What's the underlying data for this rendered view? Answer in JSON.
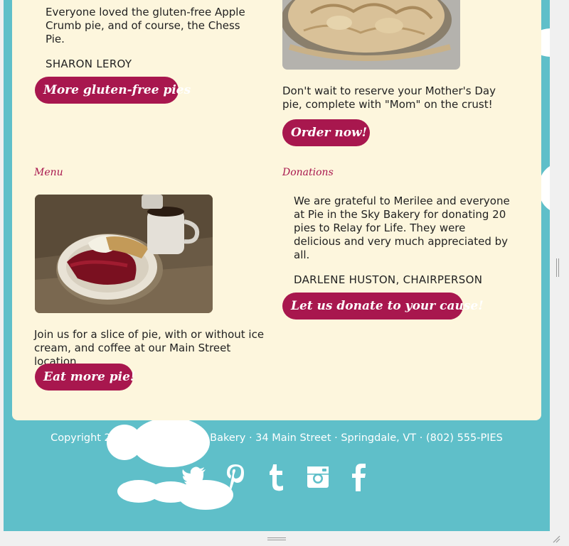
{
  "testimonial_top": {
    "quote": "Everyone loved the gluten-free Apple Crumb pie, and of course, the Chess Pie.",
    "author": "SHARON LEROY",
    "button": "More gluten-free pies"
  },
  "mothers_day": {
    "text": "Don't wait to reserve your Mother's Day pie, complete with \"Mom\" on the crust!",
    "button": "Order now!"
  },
  "menu": {
    "heading": "Menu",
    "text": "Join us for a slice of pie, with or without ice cream, and coffee at our Main Street location.",
    "button": "Eat more pie!"
  },
  "donations": {
    "heading": "Donations",
    "quote": "We are grateful to Merilee and everyone at Pie in the Sky Bakery for donating 20 pies to Relay for Life. They were delicious and very much appreciated by all.",
    "author": "DARLENE HUSTON, CHAIRPERSON",
    "button": "Let us donate to your cause!"
  },
  "footer": {
    "copyright": "Copyright 2017, Pie in the Sky Bakery · 34 Main Street · Springdale, VT · (802) 555-PIES",
    "social": [
      "twitter-icon",
      "pinterest-icon",
      "tumblr-icon",
      "instagram-icon",
      "facebook-icon"
    ]
  },
  "colors": {
    "accent": "#a8174e",
    "background": "#5fbfc9",
    "panel": "#fdf6dd"
  }
}
